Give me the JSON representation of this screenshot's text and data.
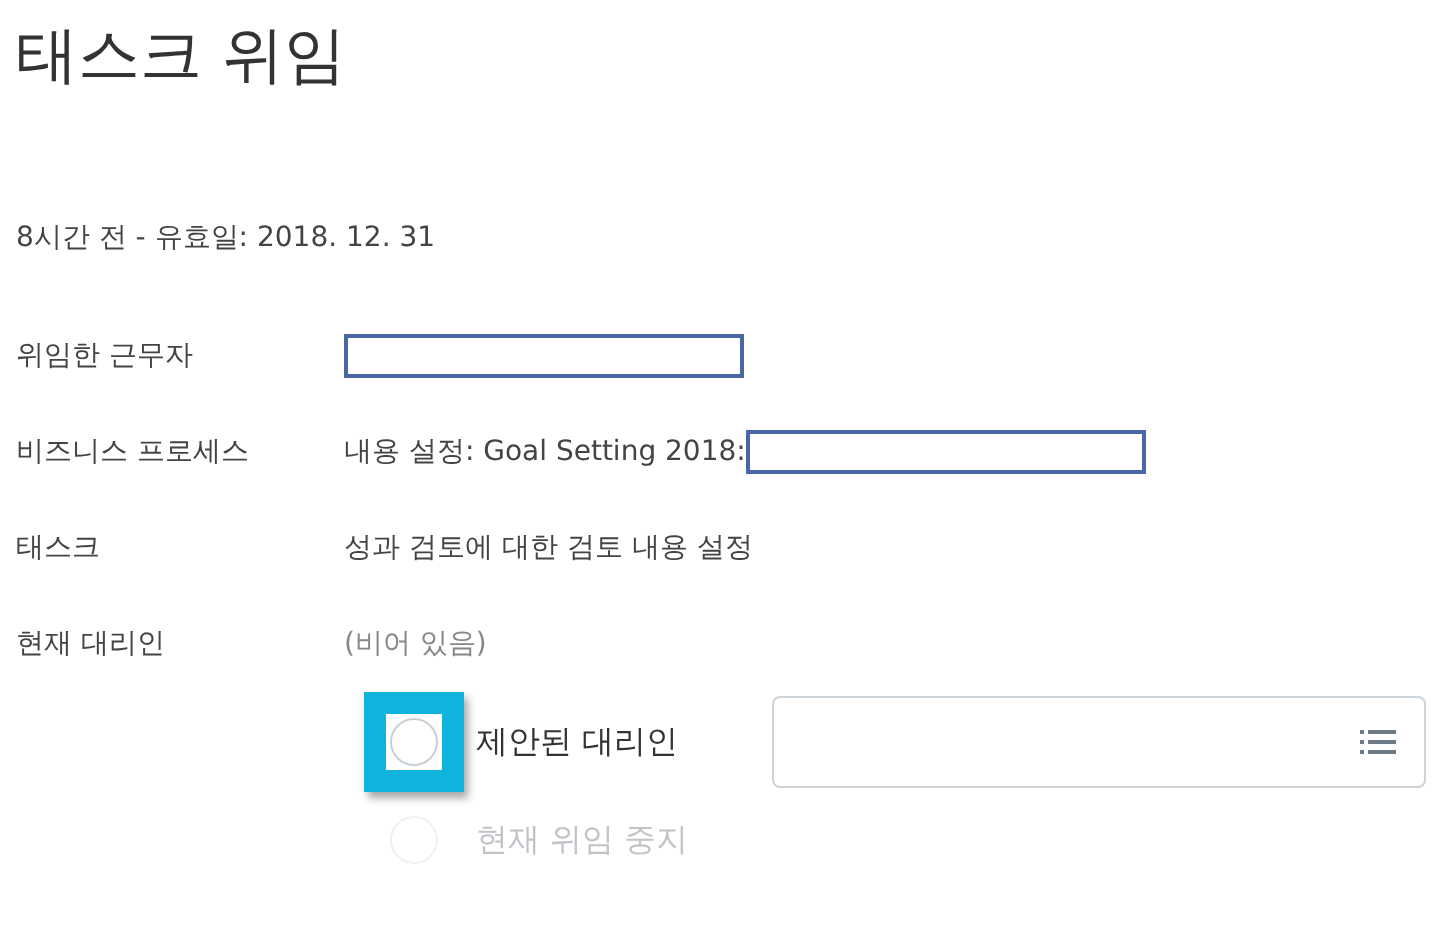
{
  "title": "태스크 위임",
  "meta": "8시간 전 -  유효일: 2018. 12. 31",
  "fields": [
    {
      "label": "위임한 근무자",
      "kind": "redacted"
    },
    {
      "label": "비즈니스 프로세스",
      "kind": "text_redacted",
      "value": "내용 설정: Goal Setting 2018:"
    },
    {
      "label": "태스크",
      "kind": "text",
      "value": "성과 검토에 대한 검토 내용 설정"
    },
    {
      "label": "현재 대리인",
      "kind": "muted",
      "value": "(비어 있음)"
    }
  ],
  "options": [
    {
      "label": "제안된 대리인",
      "selected": false,
      "disabled": false,
      "highlighted": true,
      "has_picker": true
    },
    {
      "label": "현재 위임 중지",
      "selected": false,
      "disabled": true,
      "highlighted": false,
      "has_picker": false
    }
  ]
}
